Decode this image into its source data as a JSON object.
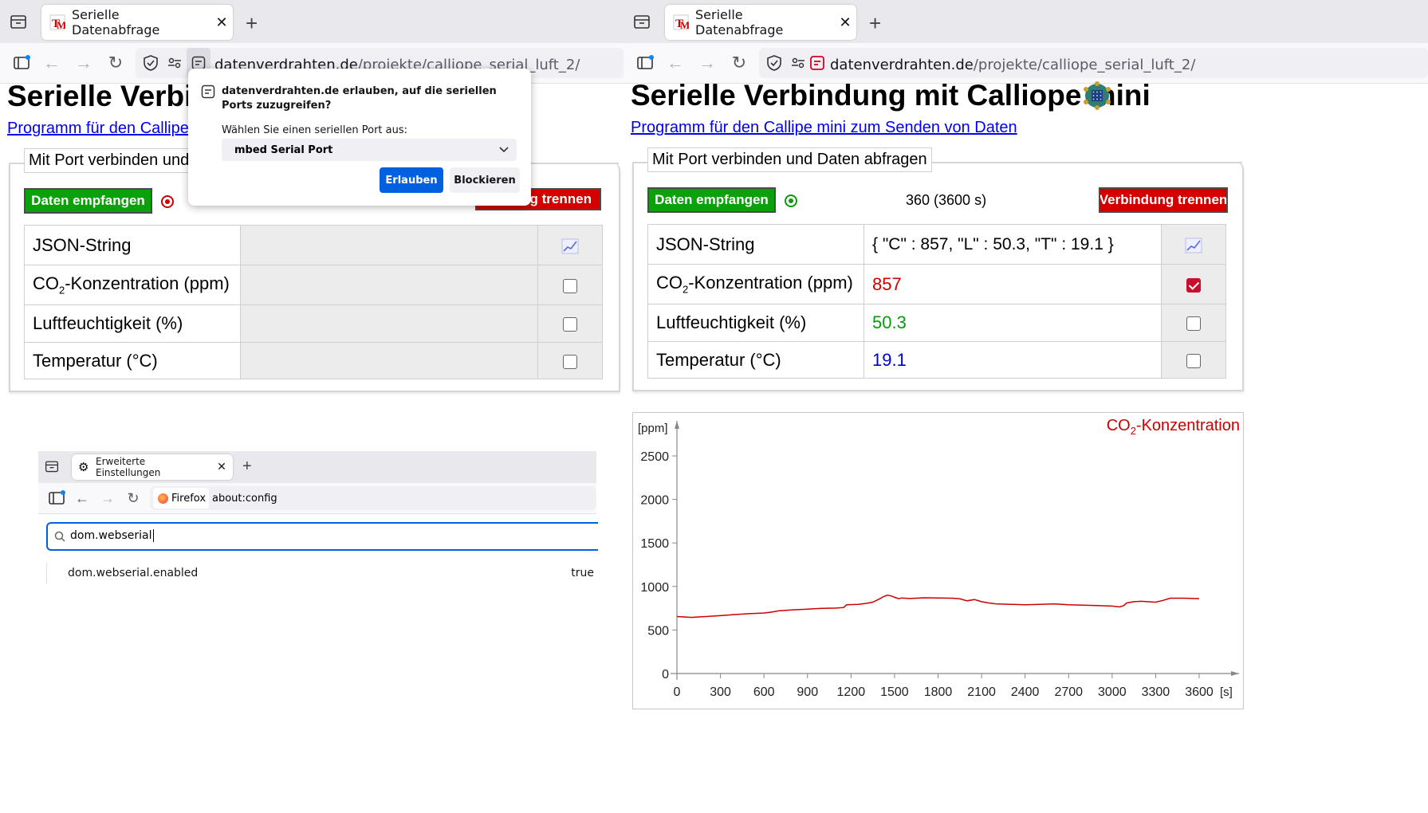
{
  "left_window": {
    "tab": {
      "title": "Serielle Datenabfrage"
    },
    "url": {
      "domain": "datenverdrahten.de",
      "path": "/projekte/calliope_serial_luft_2/"
    },
    "heading": "Serielle Verbinc",
    "link": "Programm für den Callipe mi",
    "legend": "Mit Port verbinden und Da",
    "receive_button": "Daten empfangen",
    "disconnect_button": "ng trennen",
    "rows": [
      {
        "label": "JSON-String"
      },
      {
        "label_pre": "CO",
        "label_sub": "2",
        "label_post": "-Konzentration (ppm)"
      },
      {
        "label": "Luftfeuchtigkeit (%)"
      },
      {
        "label": "Temperatur (°C)"
      }
    ]
  },
  "permission_popup": {
    "title": "datenverdrahten.de erlauben, auf die seriellen Ports zuzugreifen?",
    "select_label": "Wählen Sie einen seriellen Port aus:",
    "selected_port": "mbed Serial Port",
    "allow_button": "Erlauben",
    "block_button": "Blockieren"
  },
  "config_window": {
    "tab": {
      "title": "Erweiterte Einstellungen"
    },
    "identity_label": "Firefox",
    "url": "about:config",
    "search_value": "dom.webserial",
    "pref": {
      "name": "dom.webserial.enabled",
      "value": "true"
    }
  },
  "right_window": {
    "tab": {
      "title": "Serielle Datenabfrage"
    },
    "url": {
      "domain": "datenverdrahten.de",
      "path": "/projekte/calliope_serial_luft_2/"
    },
    "heading": "Serielle Verbindung mit Calliope mini",
    "link": "Programm für den Callipe mini zum Senden von Daten",
    "legend": "Mit Port verbinden und Daten abfragen",
    "receive_button": "Daten empfangen",
    "counter": "360 (3600 s)",
    "disconnect_button": "Verbindung trennen",
    "rows": [
      {
        "label": "JSON-String",
        "value": "{ \"C\" : 857, \"L\" : 50.3, \"T\" : 19.1 }"
      },
      {
        "label_pre": "CO",
        "label_sub": "2",
        "label_post": "-Konzentration (ppm)",
        "value": "857",
        "checked": true
      },
      {
        "label": "Luftfeuchtigkeit (%)",
        "value": "50.3",
        "checked": false
      },
      {
        "label": "Temperatur (°C)",
        "value": "19.1",
        "checked": false
      }
    ],
    "colors": {
      "co2": "#cc0000",
      "humidity": "#0a9a0a",
      "temperature": "#0000cc"
    }
  },
  "chart_data": {
    "type": "line",
    "title_pre": "CO",
    "title_sub": "2",
    "title_post": "-Konzentration",
    "ylabel": "[ppm]",
    "xlabel": "[s]",
    "ylim": [
      0,
      2500
    ],
    "xlim": [
      0,
      3600
    ],
    "yticks": [
      0,
      500,
      1000,
      1500,
      2000,
      2500
    ],
    "xticks": [
      0,
      300,
      600,
      900,
      1200,
      1500,
      1800,
      2100,
      2400,
      2700,
      3000,
      3300,
      3600
    ],
    "color": "#cc0000",
    "series": [
      {
        "x": [
          0,
          50,
          100,
          150,
          200,
          300,
          400,
          500,
          600,
          650,
          700,
          800,
          900,
          1000,
          1100,
          1150,
          1170,
          1250,
          1300,
          1350,
          1400,
          1420,
          1450,
          1480,
          1500,
          1530,
          1550,
          1600,
          1650,
          1700,
          1800,
          1900,
          1950,
          2000,
          2050,
          2100,
          2150,
          2200,
          2300,
          2400,
          2500,
          2600,
          2700,
          2800,
          2900,
          3000,
          3050,
          3080,
          3100,
          3150,
          3200,
          3300,
          3350,
          3400,
          3500,
          3600
        ],
        "y": [
          655,
          650,
          645,
          650,
          655,
          665,
          678,
          688,
          695,
          705,
          720,
          732,
          740,
          748,
          752,
          758,
          790,
          795,
          805,
          820,
          860,
          880,
          900,
          890,
          875,
          860,
          868,
          862,
          865,
          870,
          868,
          865,
          858,
          835,
          850,
          825,
          810,
          800,
          795,
          790,
          795,
          800,
          790,
          785,
          780,
          775,
          765,
          780,
          810,
          825,
          830,
          820,
          840,
          865,
          865,
          860
        ]
      }
    ]
  }
}
